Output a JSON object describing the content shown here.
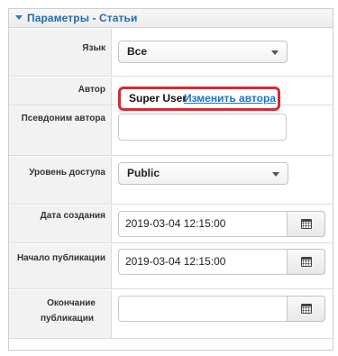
{
  "panel": {
    "title": "Параметры - Статьи"
  },
  "fields": {
    "language": {
      "label": "Язык",
      "value": "Все"
    },
    "author": {
      "label": "Автор",
      "value": "Super User",
      "change_link": "Изменить автора"
    },
    "alias": {
      "label": "Псевдоним автора",
      "value": ""
    },
    "access": {
      "label": "Уровень доступа",
      "value": "Public"
    },
    "created": {
      "label": "Дата создания",
      "value": "2019-03-04 12:15:00"
    },
    "publish_up": {
      "label": "Начало публикации",
      "value": "2019-03-04 12:15:00"
    },
    "publish_down": {
      "label_line1": "Окончание",
      "label_line2": "публикации",
      "value": ""
    }
  },
  "colors": {
    "header_text": "#1e6db2",
    "highlight_border": "#e0272e",
    "link": "#1f73c8"
  },
  "icons": {
    "panel_toggle": "triangle-down-icon",
    "calendar": "calendar-icon"
  }
}
